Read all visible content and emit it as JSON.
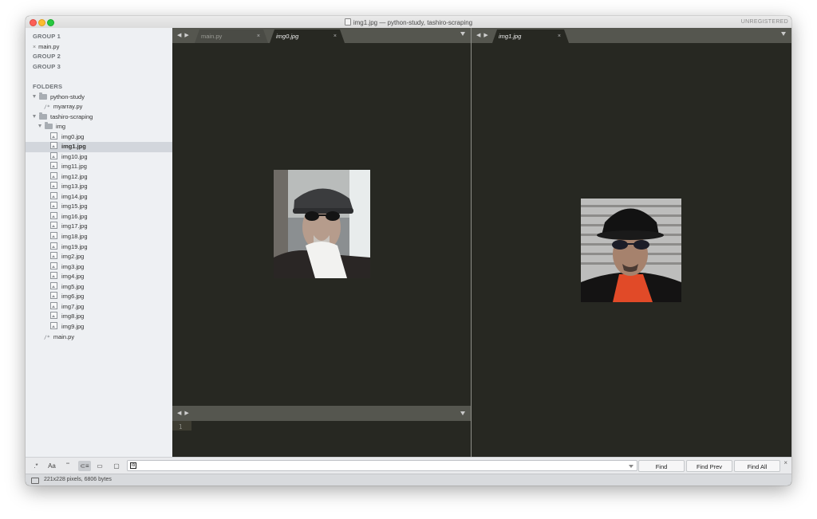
{
  "window": {
    "title": "img1.jpg — python-study, tashiro-scraping",
    "registration": "UNREGISTERED"
  },
  "sidebar": {
    "groups": [
      {
        "label": "GROUP 1",
        "files": [
          "main.py"
        ]
      },
      {
        "label": "GROUP 2",
        "files": []
      },
      {
        "label": "GROUP 3",
        "files": []
      }
    ],
    "folders_label": "FOLDERS",
    "folders": [
      {
        "name": "python-study",
        "files": [
          "myarray.py"
        ]
      },
      {
        "name": "tashiro-scraping",
        "subfolder": "img",
        "images": [
          "img0.jpg",
          "img1.jpg",
          "img10.jpg",
          "img11.jpg",
          "img12.jpg",
          "img13.jpg",
          "img14.jpg",
          "img15.jpg",
          "img16.jpg",
          "img17.jpg",
          "img18.jpg",
          "img19.jpg",
          "img2.jpg",
          "img3.jpg",
          "img4.jpg",
          "img5.jpg",
          "img6.jpg",
          "img7.jpg",
          "img8.jpg",
          "img9.jpg"
        ],
        "selected": "img1.jpg",
        "files": [
          "main.py"
        ]
      }
    ]
  },
  "left_group": {
    "tabs": [
      {
        "label": "main.py",
        "active": false
      },
      {
        "label": "img0.jpg",
        "active": true
      }
    ],
    "lower_pane": {
      "line_numbers": [
        "1"
      ]
    }
  },
  "right_group": {
    "tabs": [
      {
        "label": "img1.jpg",
        "active": true
      }
    ]
  },
  "icons": {
    "tab_close": "×",
    "tab_nav": "◀ ▶",
    "file_close": "×",
    "code_file": "/*"
  },
  "findbar": {
    "toggles": [
      ".*",
      "Aa",
      "\"\"",
      "⊂≡",
      "▭",
      "▢"
    ],
    "input_value": "",
    "input_glyph": "iti",
    "buttons": {
      "find": "Find",
      "find_prev": "Find Prev",
      "find_all": "Find All"
    },
    "close": "×"
  },
  "status": {
    "text": "221x228 pixels, 6806 bytes"
  },
  "colors": {
    "editor_bg": "#272822",
    "tabbar_bg": "#55564f",
    "sidebar_bg": "#eef0f3",
    "selected_row": "#d2d6dc"
  }
}
